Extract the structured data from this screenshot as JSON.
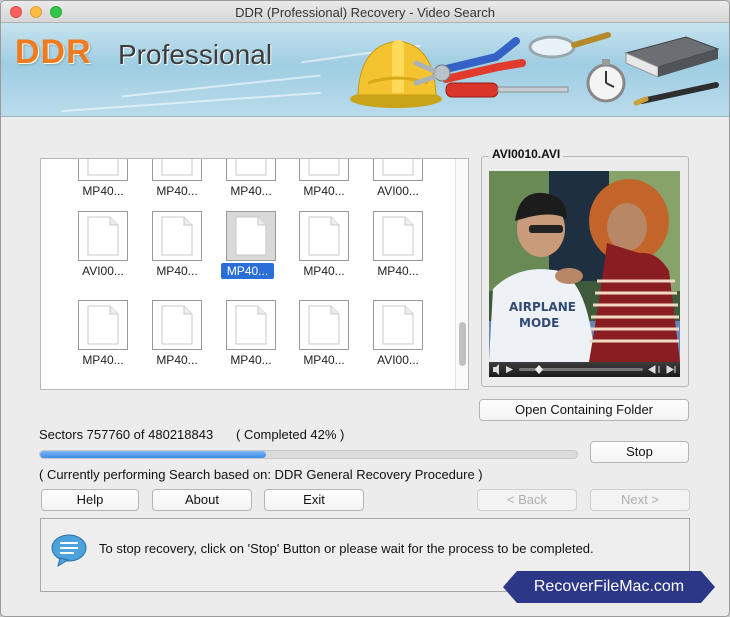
{
  "window": {
    "title": "DDR (Professional) Recovery - Video Search"
  },
  "banner": {
    "brand": "DDR",
    "product": "Professional"
  },
  "files": [
    {
      "name": "MP40...",
      "selected": false
    },
    {
      "name": "MP40...",
      "selected": false
    },
    {
      "name": "MP40...",
      "selected": false
    },
    {
      "name": "MP40...",
      "selected": false
    },
    {
      "name": "AVI00...",
      "selected": false
    },
    {
      "name": "AVI00...",
      "selected": false
    },
    {
      "name": "MP40...",
      "selected": false
    },
    {
      "name": "MP40...",
      "selected": true
    },
    {
      "name": "MP40...",
      "selected": false
    },
    {
      "name": "MP40...",
      "selected": false
    },
    {
      "name": "MP40...",
      "selected": false
    },
    {
      "name": "MP40...",
      "selected": false
    },
    {
      "name": "MP40...",
      "selected": false
    },
    {
      "name": "MP40...",
      "selected": false
    },
    {
      "name": "AVI00...",
      "selected": false
    }
  ],
  "preview": {
    "file_name": "AVI0010.AVI",
    "shirt_text_1": "AIRPLANE",
    "shirt_text_2": "MODE"
  },
  "buttons": {
    "open_folder": "Open Containing Folder",
    "stop": "Stop",
    "help": "Help",
    "about": "About",
    "exit": "Exit",
    "back": "< Back",
    "next": "Next >"
  },
  "status": {
    "sectors": "Sectors 757760 of 480218843",
    "completed": "( Completed 42% )",
    "progress_percent": 42,
    "procedure": "( Currently performing Search based on: DDR General Recovery Procedure )"
  },
  "message": {
    "text": "To stop recovery, click on 'Stop' Button or please wait for the process to be completed."
  },
  "watermark": {
    "text": "RecoverFileMac.com"
  },
  "colors": {
    "accent": "#2a6ed8",
    "brand_orange": "#f07a1e",
    "watermark_bg": "#2c3787"
  }
}
